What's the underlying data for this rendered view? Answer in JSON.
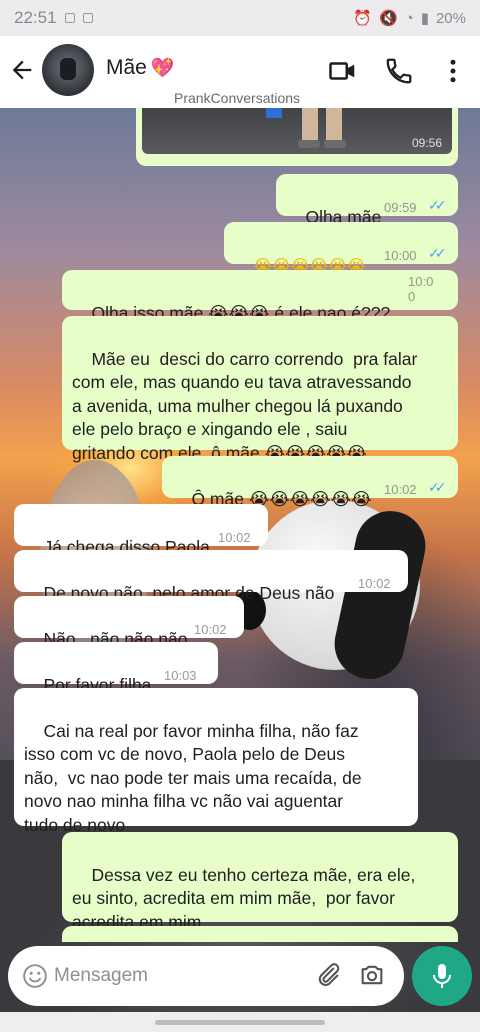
{
  "status_bar": {
    "time": "22:51",
    "battery": "20%"
  },
  "header": {
    "contact_name": "Mãe",
    "heart": "💖",
    "watermark": "PrankConversations"
  },
  "image_message": {
    "time": "09:56"
  },
  "messages": [
    {
      "dir": "out",
      "text": "Olha mãe",
      "time": "09:59",
      "ticks": "✓✓"
    },
    {
      "dir": "out",
      "text": "😭😭😭😭😭😭",
      "time": "10:00",
      "ticks": "✓✓"
    },
    {
      "dir": "out",
      "text": "Olha isso mãe 😭😭😭 é ele nao é???",
      "time": "10:00"
    },
    {
      "dir": "out",
      "text": "Mãe eu  desci do carro correndo  pra falar\ncom ele, mas quando eu tava atravessando\na avenida, uma mulher chegou lá puxando\nele pelo braço e xingando ele , saiu\ngritando com ele, ô mãe 😭😭😭😭😭"
    },
    {
      "dir": "out",
      "text": "Ô mãe 😭😭😭😭😭😭",
      "time": "10:02",
      "ticks": "✓✓"
    },
    {
      "dir": "in",
      "text": "Já chega disso Paola",
      "time": "10:02"
    },
    {
      "dir": "in",
      "text": "De novo não, pelo amor de Deus não",
      "time": "10:02"
    },
    {
      "dir": "in",
      "text": "Não,  não não não",
      "time": "10:02"
    },
    {
      "dir": "in",
      "text": "Por favor filha",
      "time": "10:03"
    },
    {
      "dir": "in",
      "text": "Cai na real por favor minha filha, não faz\nisso com vc de novo, Paola pelo de Deus\nnão,  vc nao pode ter mais uma recaída, de\nnovo nao minha filha vc não vai aguentar\ntudo de novo"
    },
    {
      "dir": "out",
      "text": "Dessa vez eu tenho certeza mãe, era ele,\neu sinto, acredita em mim mãe,  por favor\nacredita em mim"
    }
  ],
  "input": {
    "placeholder": "Mensagem"
  },
  "colors": {
    "outgoing": "#e7fec9",
    "incoming": "#ffffff",
    "accent": "#1fa885",
    "ticks": "#4fa3e8"
  },
  "icons": [
    "back-arrow-icon",
    "video-call-icon",
    "phone-icon",
    "more-vert-icon",
    "emoji-icon",
    "attach-icon",
    "camera-icon",
    "mic-icon"
  ]
}
